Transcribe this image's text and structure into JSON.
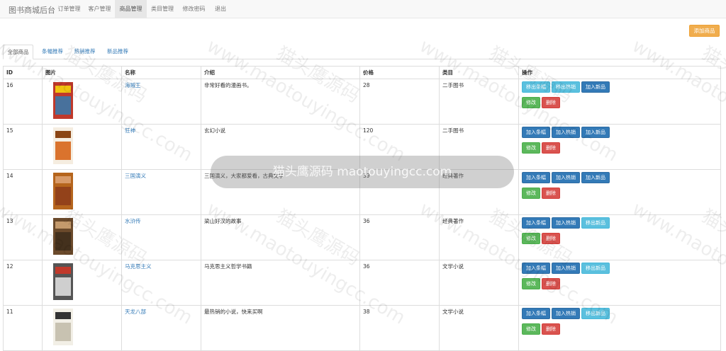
{
  "navbar": {
    "brand": "图书商城后台",
    "items": [
      "订单管理",
      "客户管理",
      "商品管理",
      "类目管理",
      "修改密码",
      "退出"
    ],
    "active_index": 2
  },
  "toolbar": {
    "add_label": "添加商品"
  },
  "tabs": [
    "全部商品",
    "条幅推荐",
    "热销推荐",
    "新品推荐"
  ],
  "table": {
    "headers": [
      "ID",
      "图片",
      "名称",
      "介绍",
      "价格",
      "类目",
      "操作"
    ],
    "rows": [
      {
        "id": "16",
        "name": "海贼王",
        "intro": "非常好看的漫画书。",
        "price": "28",
        "category": "二手图书",
        "cover_colors": [
          "#c0392b",
          "#f1c40f",
          "#2980b9"
        ],
        "buttons": [
          {
            "label": "移出条幅",
            "style": "info"
          },
          {
            "label": "移出热销",
            "style": "info"
          },
          {
            "label": "加入新品",
            "style": "primary"
          }
        ]
      },
      {
        "id": "15",
        "name": "狂神",
        "intro": "玄幻小说",
        "price": "120",
        "category": "二手图书",
        "cover_colors": [
          "#f5ede0",
          "#8b4513",
          "#d35400"
        ],
        "buttons": [
          {
            "label": "加入条幅",
            "style": "primary"
          },
          {
            "label": "加入热销",
            "style": "primary"
          },
          {
            "label": "加入新品",
            "style": "primary"
          }
        ]
      },
      {
        "id": "14",
        "name": "三国演义",
        "intro": "三国演义，大家都爱看，古典文学",
        "price": "39",
        "category": "经典著作",
        "cover_colors": [
          "#b5651d",
          "#d89b6a",
          "#8b3a1a"
        ],
        "buttons": [
          {
            "label": "加入条幅",
            "style": "primary"
          },
          {
            "label": "加入热销",
            "style": "primary"
          },
          {
            "label": "加入新品",
            "style": "primary"
          }
        ]
      },
      {
        "id": "13",
        "name": "水浒传",
        "intro": "梁山好汉的故事",
        "price": "36",
        "category": "经典著作",
        "cover_colors": [
          "#6b4a2b",
          "#c49a6c",
          "#3b2a1a"
        ],
        "buttons": [
          {
            "label": "加入条幅",
            "style": "primary"
          },
          {
            "label": "加入热销",
            "style": "primary"
          },
          {
            "label": "移出新品",
            "style": "info"
          }
        ]
      },
      {
        "id": "12",
        "name": "马克思主义",
        "intro": "马克思主义哲学书籍",
        "price": "36",
        "category": "文学小说",
        "cover_colors": [
          "#555555",
          "#c0392b",
          "#eeeeee"
        ],
        "buttons": [
          {
            "label": "加入条幅",
            "style": "primary"
          },
          {
            "label": "加入热销",
            "style": "primary"
          },
          {
            "label": "移出新品",
            "style": "info"
          }
        ]
      },
      {
        "id": "11",
        "name": "天龙八部",
        "intro": "最热销的小说，快来买啊",
        "price": "38",
        "category": "文学小说",
        "cover_colors": [
          "#f2efe6",
          "#333333",
          "#bdb7a4"
        ],
        "buttons": [
          {
            "label": "加入条幅",
            "style": "primary"
          },
          {
            "label": "加入热销",
            "style": "primary"
          },
          {
            "label": "移出新品",
            "style": "info"
          }
        ]
      }
    ],
    "edit_label": "修改",
    "delete_label": "删除"
  },
  "watermark": {
    "text": "www.maotouyingcc.com",
    "logo_text": "猫头鹰源码",
    "pill_text": "猫头鹰源码 maotouyingcc.com"
  }
}
